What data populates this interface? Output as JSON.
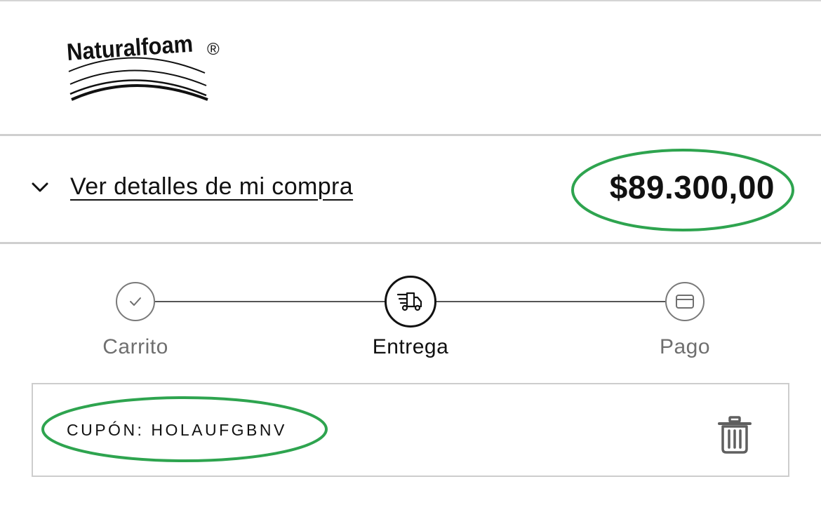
{
  "header": {
    "logo_text": "Naturalfoam",
    "logo_mark": "®"
  },
  "order_summary": {
    "toggle_label": "Ver detalles de mi compra",
    "toggle_icon": "chevron-down-icon",
    "total": "$89.300,00"
  },
  "checkout_steps": [
    {
      "label": "Carrito",
      "state": "completed",
      "icon": "check-icon"
    },
    {
      "label": "Entrega",
      "state": "current",
      "icon": "delivery-truck-icon"
    },
    {
      "label": "Pago",
      "state": "pending",
      "icon": "credit-card-icon"
    }
  ],
  "coupon": {
    "text": "CUPÓN: HOLAUFGBNV",
    "remove_icon": "trash-icon"
  },
  "annotation": {
    "highlight_color": "#2ea44f"
  }
}
